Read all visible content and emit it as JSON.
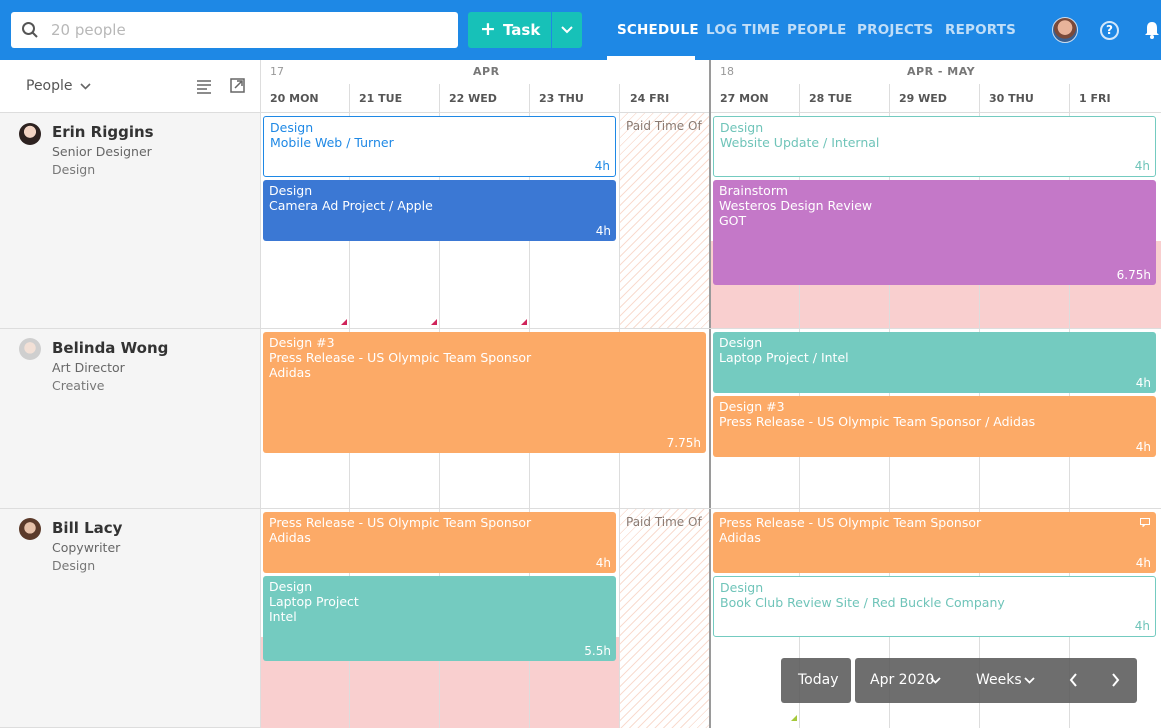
{
  "search": {
    "placeholder": "20 people"
  },
  "toolbar": {
    "task_label": "Task"
  },
  "nav": [
    "SCHEDULE",
    "LOG TIME",
    "PEOPLE",
    "PROJECTS",
    "REPORTS"
  ],
  "left_header": {
    "label": "People"
  },
  "weeks": [
    {
      "num": "17",
      "month": "APR",
      "days": [
        "20 MON",
        "21 TUE",
        "22 WED",
        "23 THU",
        "24 FRI"
      ]
    },
    {
      "num": "18",
      "month": "APR - MAY",
      "days": [
        "27 MON",
        "28 TUE",
        "29 WED",
        "30 THU",
        "1 FRI"
      ]
    }
  ],
  "people": [
    {
      "name": "Erin Riggins",
      "role": "Senior Designer",
      "dept": "Design"
    },
    {
      "name": "Belinda Wong",
      "role": "Art Director",
      "dept": "Creative"
    },
    {
      "name": "Bill Lacy",
      "role": "Copywriter",
      "dept": "Design"
    }
  ],
  "pto_label": "Paid Time Of",
  "tasks": {
    "erin_1": {
      "l1": "Design",
      "l2": "Mobile Web / Turner",
      "hrs": "4h"
    },
    "erin_2": {
      "l1": "Design",
      "l2": "Camera Ad Project / Apple",
      "hrs": "4h"
    },
    "erin_3": {
      "l1": "Design",
      "l2": "Website Update / Internal",
      "hrs": "4h"
    },
    "erin_4": {
      "l1": "Brainstorm",
      "l2": "Westeros Design Review",
      "l3": "GOT",
      "hrs": "6.75h"
    },
    "belinda_1": {
      "l1": "Design #3",
      "l2": "Press Release - US Olympic Team Sponsor",
      "l3": "Adidas",
      "hrs": "7.75h"
    },
    "belinda_2": {
      "l1": "Design",
      "l2": "Laptop Project / Intel",
      "hrs": "4h"
    },
    "belinda_3": {
      "l1": "Design #3",
      "l2": "Press Release - US Olympic Team Sponsor / Adidas",
      "hrs": "4h"
    },
    "bill_1": {
      "l1": "Press Release - US Olympic Team Sponsor",
      "l2": "Adidas",
      "hrs": "4h"
    },
    "bill_2": {
      "l1": "Design",
      "l2": "Laptop Project",
      "l3": "Intel",
      "hrs": "5.5h"
    },
    "bill_3": {
      "l1": "Press Release - US Olympic Team Sponsor",
      "l2": "Adidas",
      "hrs": "4h"
    },
    "bill_4": {
      "l1": "Design",
      "l2": "Book Club Review Site / Red Buckle Company",
      "hrs": "4h"
    }
  },
  "controls": {
    "today": "Today",
    "period": "Apr 2020",
    "view": "Weeks"
  },
  "colors": {
    "topbar": "#1e88e5",
    "task_button": "#17c1b8",
    "blue_task": "#3b78d4",
    "purple_task": "#c478c8",
    "orange_task": "#fcaa67",
    "teal_task": "#74cbc0"
  }
}
